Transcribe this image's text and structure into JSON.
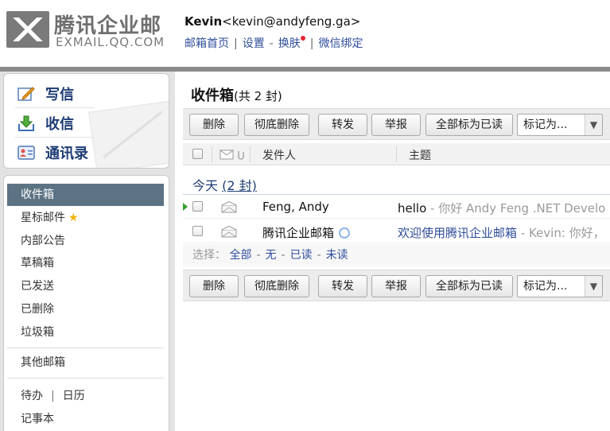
{
  "header": {
    "logo_cn": "腾讯企业邮",
    "logo_en": "EXMAIL.QQ.COM",
    "user_name": "Kevin",
    "user_email": "<kevin@andyfeng.ga>",
    "links": [
      "邮箱首页",
      "设置",
      "换肤",
      "微信绑定"
    ],
    "link_separator": "|",
    "theme_dash": "-"
  },
  "sidebar": {
    "quick": [
      {
        "label": "写信",
        "icon": "compose-icon"
      },
      {
        "label": "收信",
        "icon": "inbox-download-icon"
      },
      {
        "label": "通讯录",
        "icon": "contacts-icon"
      }
    ],
    "folders": [
      {
        "label": "收件箱",
        "active": true
      },
      {
        "label": "星标邮件",
        "star": "★"
      },
      {
        "label": "内部公告"
      },
      {
        "label": "草稿箱"
      },
      {
        "label": "已发送"
      },
      {
        "label": "已删除"
      },
      {
        "label": "垃圾箱"
      }
    ],
    "other_mailbox": "其他邮箱",
    "todo": "待办",
    "calendar": "日历",
    "pipe": "|",
    "notebook": "记事本"
  },
  "main": {
    "title": "收件箱",
    "count_text": "(共 2 封)",
    "toolbar": {
      "delete": "删除",
      "delete_forever": "彻底删除",
      "forward": "转发",
      "report": "举报",
      "mark_all_read": "全部标为已读",
      "mark_as": "标记为...",
      "mark_as_arrow": "▼"
    },
    "columns": {
      "sender": "发件人",
      "subject": "主题"
    },
    "group": {
      "label": "今天",
      "count": "(2 封)"
    },
    "emails": [
      {
        "sender": "Feng, Andy",
        "subject": "hello",
        "preview": " - 你好 Andy Feng .NET Develo",
        "unread_marker": true,
        "subject_color": "#111"
      },
      {
        "sender": "腾讯企业邮箱",
        "subject": "欢迎使用腾讯企业邮箱",
        "preview": " - Kevin: 你好，",
        "unread_marker": false,
        "subject_color": "#2f4d9a"
      }
    ],
    "select_bar": {
      "label": "选择：",
      "all": "全部",
      "none": "无",
      "read": "已读",
      "unread": "未读",
      "dash": "-"
    }
  }
}
